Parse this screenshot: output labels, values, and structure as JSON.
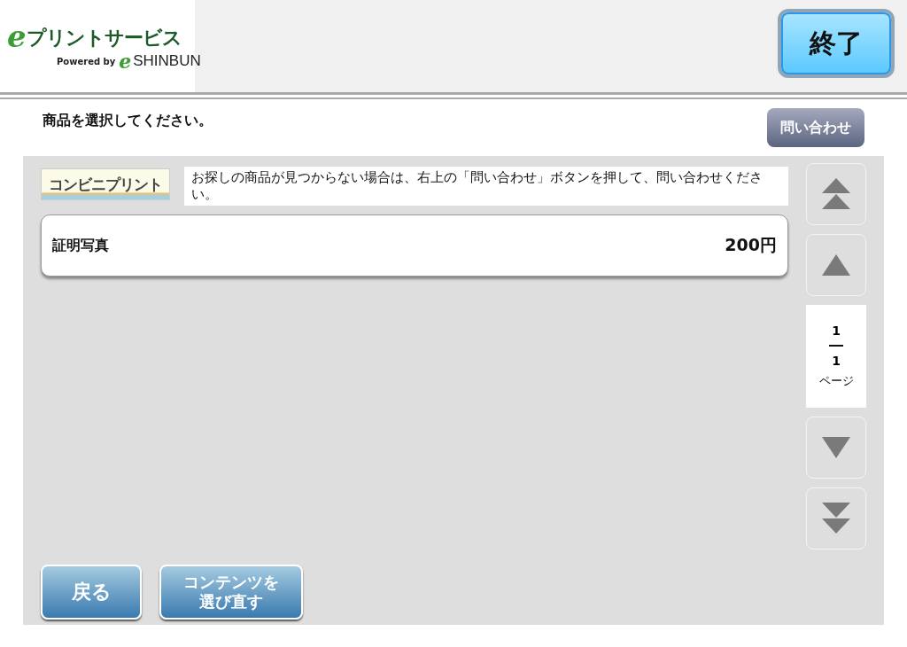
{
  "header": {
    "logo": {
      "mark": "e",
      "title": "プリントサービス",
      "powered_by": "Powered by",
      "brand_mark": "e",
      "brand": "SHINBUN"
    },
    "exit_button": "終了"
  },
  "instruction": "商品を選択してください。",
  "inquiry_button": "問い合わせ",
  "banner": {
    "text": "コンビニプリント"
  },
  "notice": "お探しの商品が見つからない場合は、右上の「問い合わせ」ボタンを押して、問い合わせください。",
  "products": [
    {
      "name": "証明写真",
      "price": "200円"
    }
  ],
  "pager": {
    "current": "1",
    "total": "1",
    "unit": "ページ",
    "buttons": [
      {
        "kind": "first"
      },
      {
        "kind": "prev"
      },
      {
        "kind": "next"
      },
      {
        "kind": "last"
      }
    ]
  },
  "footer_buttons": [
    {
      "label": "戻る",
      "kind": "back"
    },
    {
      "label": "コンテンツを選び直す",
      "kind": "reselect"
    }
  ]
}
